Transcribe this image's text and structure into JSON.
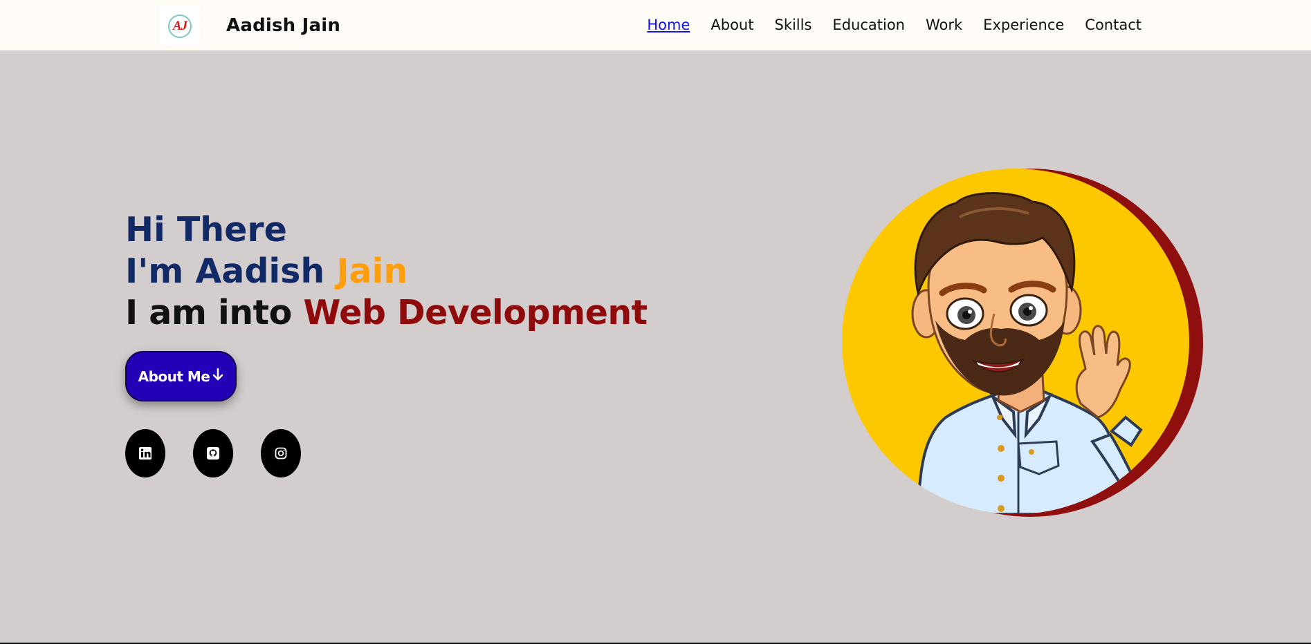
{
  "header": {
    "logo_text": "AJ",
    "brand_name": "Aadish Jain",
    "nav": [
      {
        "label": "Home",
        "active": true
      },
      {
        "label": "About",
        "active": false
      },
      {
        "label": "Skills",
        "active": false
      },
      {
        "label": "Education",
        "active": false
      },
      {
        "label": "Work",
        "active": false
      },
      {
        "label": "Experience",
        "active": false
      },
      {
        "label": "Contact",
        "active": false
      }
    ]
  },
  "hero": {
    "greeting": "Hi There",
    "name_prefix": "I'm Aadish ",
    "name_accent": "Jain",
    "role_prefix": "I am into ",
    "role_accent": "Web Development",
    "cta_label": "About Me",
    "cta_icon": "arrow-down-icon",
    "socials": [
      {
        "icon": "linkedin-icon"
      },
      {
        "icon": "github-icon"
      },
      {
        "icon": "instagram-icon"
      }
    ],
    "avatar_icon": "bitmoji-avatar"
  },
  "colors": {
    "header_bg": "#fffcf8",
    "page_bg": "#d4cdcd",
    "navy": "#112a66",
    "orange": "#ff9f0e",
    "maroon": "#8f0a0a",
    "button_bg": "#2400b7",
    "active_link": "#1010e8",
    "avatar_bg": "#fdc800"
  }
}
